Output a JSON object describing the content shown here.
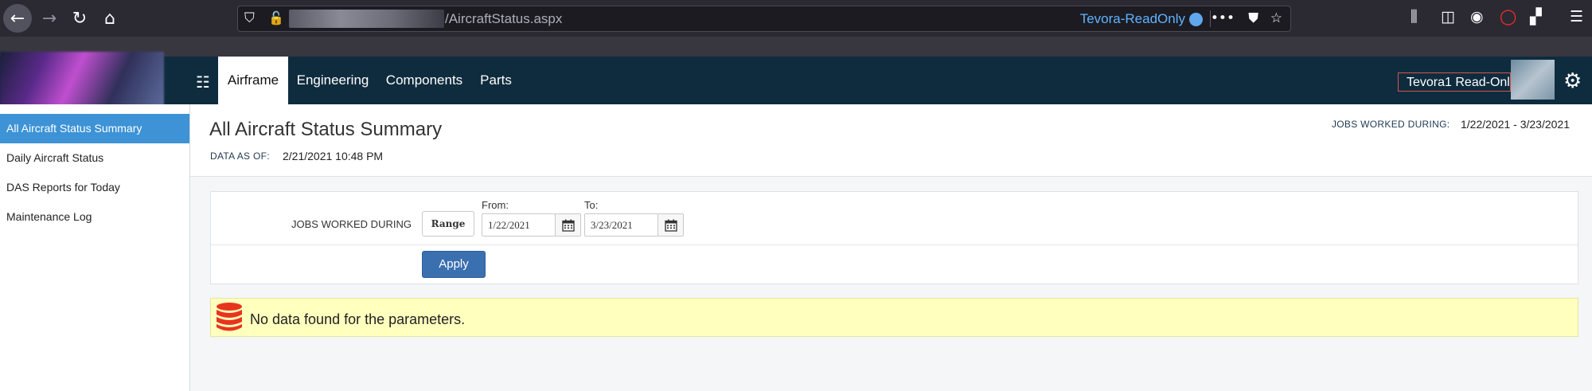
{
  "browser": {
    "url_path": "/AircraftStatus.aspx",
    "account_name": "Tevora-ReadOnly"
  },
  "nav": {
    "tabs": [
      {
        "label": "Airframe",
        "active": true
      },
      {
        "label": "Engineering"
      },
      {
        "label": "Components"
      },
      {
        "label": "Parts"
      }
    ],
    "user_label": "Tevora1 Read-Only"
  },
  "sidebar": {
    "items": [
      {
        "label": "All Aircraft Status Summary",
        "active": true
      },
      {
        "label": "Daily Aircraft Status"
      },
      {
        "label": "DAS Reports for Today"
      },
      {
        "label": "Maintenance Log"
      }
    ]
  },
  "header": {
    "title": "All Aircraft Status Summary",
    "data_as_of_label": "DATA AS OF:",
    "data_as_of_value": "2/21/2021 10:48 PM",
    "jobs_worked_label": "JOBS WORKED DURING:",
    "jobs_worked_value": "1/22/2021 - 3/23/2021"
  },
  "filter": {
    "label": "JOBS WORKED DURING",
    "range_button": "Range",
    "from_label": "From:",
    "from_value": "1/22/2021",
    "to_label": "To:",
    "to_value": "3/23/2021",
    "apply_button": "Apply"
  },
  "alert": {
    "message": "No data found for the parameters."
  },
  "colors": {
    "nav_background": "#0f2c3e",
    "sidebar_active": "#3d93d6",
    "apply_button": "#3a6fb0",
    "alert_background": "#ffffbe",
    "database_icon": "#e8341c"
  }
}
